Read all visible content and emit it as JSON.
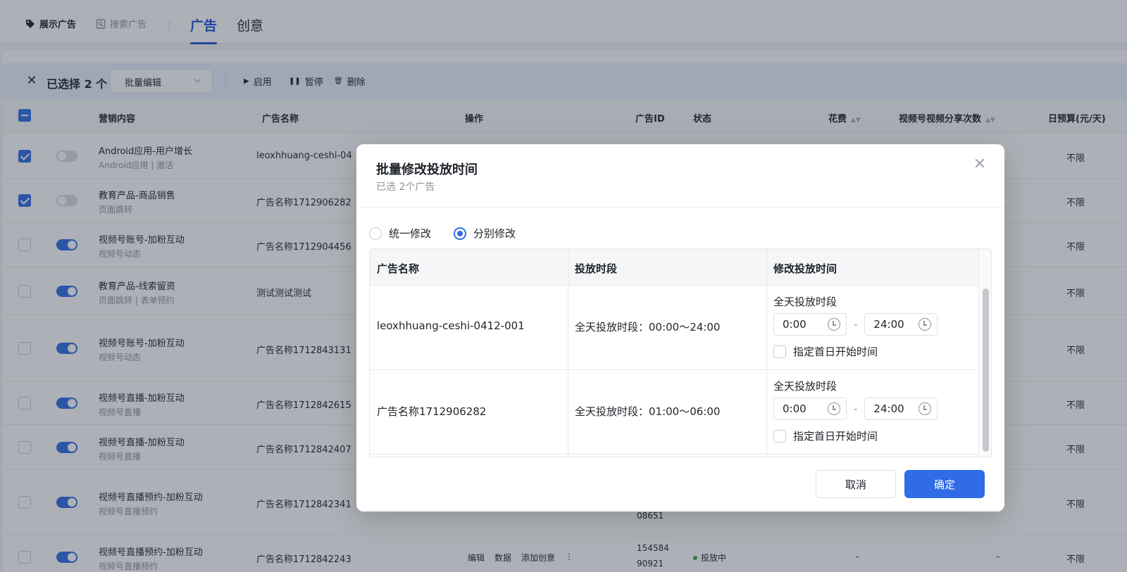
{
  "topnav": {
    "display_ads": "展示广告",
    "search_ads": "搜索广告",
    "tab_ads": "广告",
    "tab_creative": "创意"
  },
  "batchbar": {
    "selected": "已选择 2 个",
    "batch_edit": "批量编辑",
    "enable": "启用",
    "pause": "暂停",
    "delete": "删除"
  },
  "table": {
    "headers": {
      "marketing": "营销内容",
      "ad_name": "广告名称",
      "ops": "操作",
      "ad_id": "广告ID",
      "status": "状态",
      "cost": "花费",
      "video_shares": "视频号视频分享次数",
      "daily_budget": "日预算(元/天)"
    },
    "rows": [
      {
        "title": "Android应用-用户增长",
        "sub": "Android应用 | 激活",
        "name": "leoxhhuang-ceshi-04",
        "budget": "不限"
      },
      {
        "title": "教育产品-商品销售",
        "sub": "页面跳转",
        "name": "广告名称1712906282",
        "budget": "不限"
      },
      {
        "title": "视频号账号-加粉互动",
        "sub": "视频号动态",
        "name": "广告名称1712904456",
        "budget": "不限"
      },
      {
        "title": "教育产品-线索留资",
        "sub": "页面跳转 | 表单预约",
        "name": "测试测试测试",
        "budget": "不限"
      },
      {
        "title": "视频号账号-加粉互动",
        "sub": "视频号动态",
        "name": "广告名称1712843131",
        "budget": "不限"
      },
      {
        "title": "视频号直播-加粉互动",
        "sub": "视频号直播",
        "name": "广告名称1712842615",
        "budget": "不限"
      },
      {
        "title": "视频号直播-加粉互动",
        "sub": "视频号直播",
        "name": "广告名称1712842407",
        "budget": "不限"
      },
      {
        "title": "视频号直播预约-加粉互动",
        "sub": "视频号直播预约",
        "name": "广告名称1712842341",
        "budget": "不限",
        "id_tail": "08651"
      },
      {
        "title": "视频号直播预约-加粉互动",
        "sub": "视频号直播预约",
        "name": "广告名称1712842243",
        "budget": "不限",
        "ops": [
          "编辑",
          "数据",
          "添加创意",
          "⋮"
        ],
        "id_line1": "154584",
        "id_line2": "90921",
        "status": "投放中",
        "cost": "–",
        "shares": "–"
      }
    ]
  },
  "modal": {
    "title": "批量修改投放时间",
    "subtitle": "已选 2个广告",
    "radio_unified": "统一修改",
    "radio_separate": "分别修改",
    "headers": {
      "name": "广告名称",
      "period": "投放时段",
      "edit": "修改投放时间"
    },
    "rows": [
      {
        "name": "leoxhhuang-ceshi-0412-001",
        "period": "全天投放时段：00:00～24:00",
        "label": "全天投放时段",
        "start": "0:00",
        "end": "24:00",
        "firstday": "指定首日开始时间"
      },
      {
        "name": "广告名称1712906282",
        "period": "全天投放时段：01:00～06:00",
        "label": "全天投放时段",
        "start": "0:00",
        "end": "24:00",
        "firstday": "指定首日开始时间"
      }
    ],
    "cancel": "取消",
    "confirm": "确定"
  }
}
